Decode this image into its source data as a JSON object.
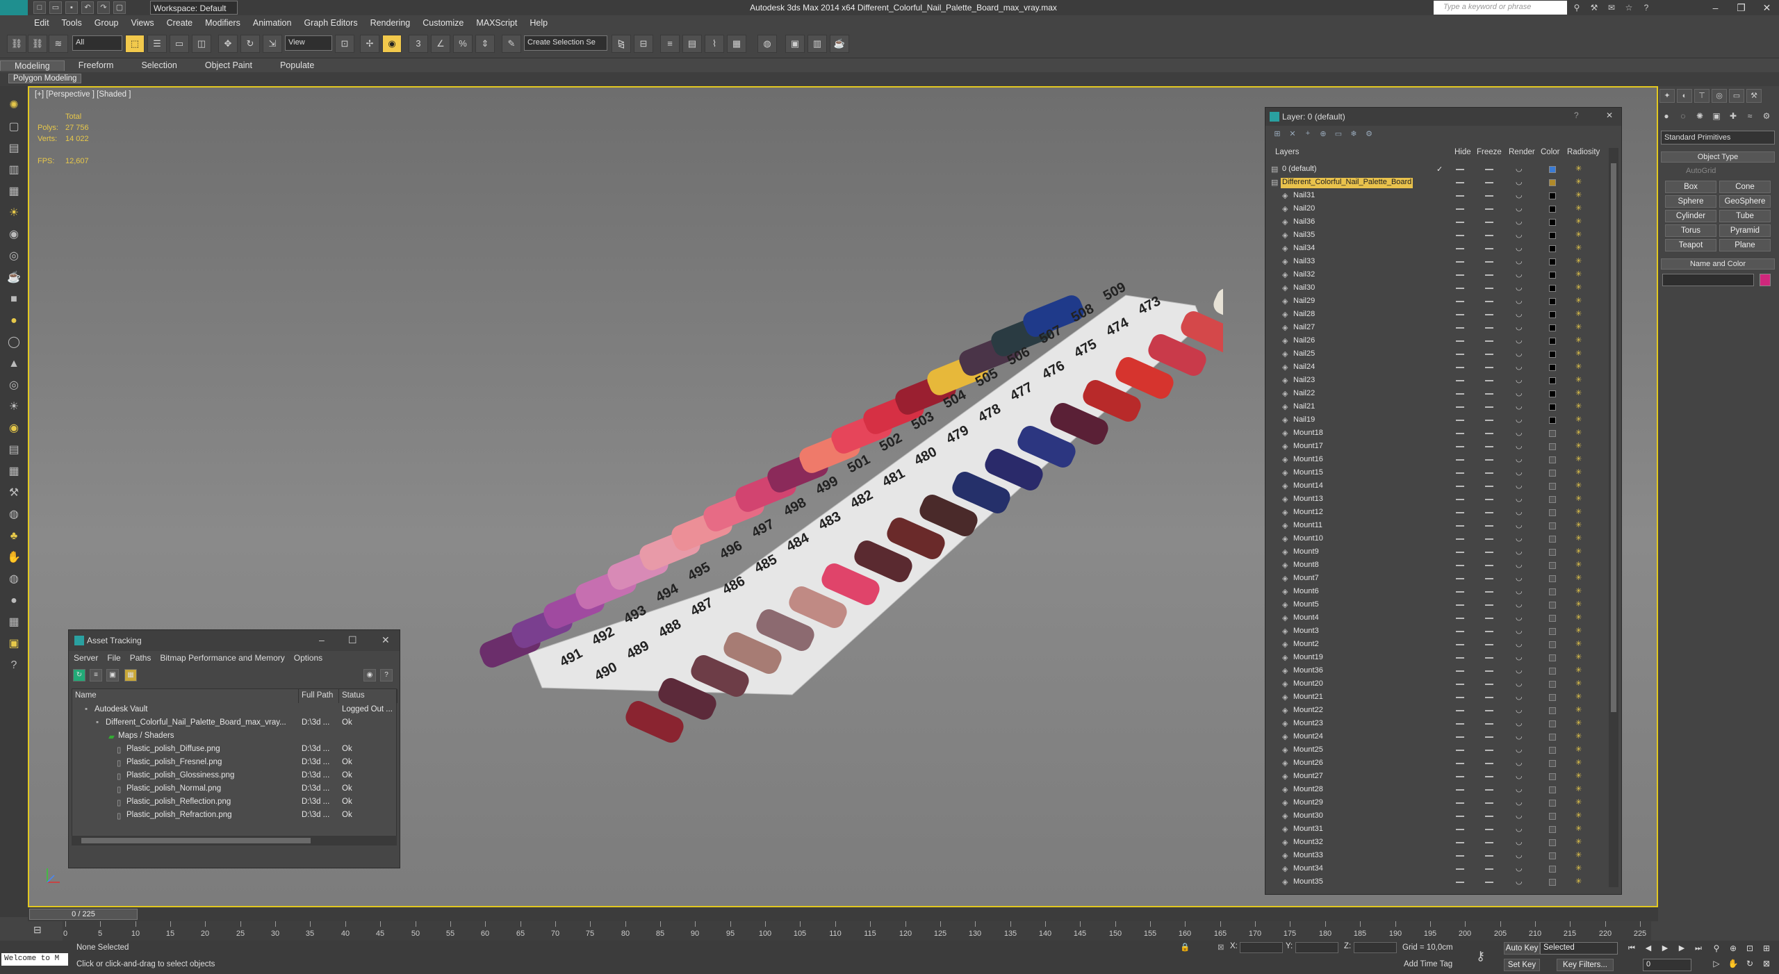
{
  "app": {
    "title": "Autodesk 3ds Max  2014 x64    Different_Colorful_Nail_Palette_Board_max_vray.max",
    "workspace": "Workspace: Default",
    "search_placeholder": "Type a keyword or phrase"
  },
  "menu": [
    "Edit",
    "Tools",
    "Group",
    "Views",
    "Create",
    "Modifiers",
    "Animation",
    "Graph Editors",
    "Rendering",
    "Customize",
    "MAXScript",
    "Help"
  ],
  "toolbar": {
    "filter": "All",
    "view": "View",
    "selection_set": "Create Selection Se"
  },
  "ribbon": {
    "tabs": [
      "Modeling",
      "Freeform",
      "Selection",
      "Object Paint",
      "Populate"
    ],
    "active": "Modeling",
    "sub": "Polygon Modeling"
  },
  "viewport": {
    "label": "[+] [Perspective ] [Shaded ]",
    "stats": {
      "total_label": "Total",
      "polys_label": "Polys:",
      "polys": "27 756",
      "verts_label": "Verts:",
      "verts": "14 022",
      "fps_label": "FPS:",
      "fps": "12,607"
    }
  },
  "board": {
    "numbers_top": [
      "491",
      "492",
      "493",
      "494",
      "495",
      "496",
      "497",
      "498",
      "499",
      "501",
      "502",
      "503",
      "504",
      "505",
      "506",
      "507",
      "508",
      "509"
    ],
    "numbers_bottom": [
      "490",
      "489",
      "488",
      "487",
      "486",
      "485",
      "484",
      "483",
      "482",
      "481",
      "480",
      "479",
      "478",
      "477",
      "476",
      "475",
      "474",
      "473"
    ]
  },
  "asset_tracking": {
    "title": "Asset Tracking",
    "menu": [
      "Server",
      "File",
      "Paths",
      "Bitmap Performance and Memory",
      "Options"
    ],
    "columns": [
      "Name",
      "Full Path",
      "Status"
    ],
    "rows": [
      {
        "name": "Autodesk Vault",
        "path": "",
        "status": "Logged Out ..."
      },
      {
        "name": "Different_Colorful_Nail_Palette_Board_max_vray...",
        "path": "D:\\3d ...",
        "status": "Ok"
      },
      {
        "name": "Maps / Shaders",
        "path": "",
        "status": ""
      },
      {
        "name": "Plastic_polish_Diffuse.png",
        "path": "D:\\3d ...",
        "status": "Ok"
      },
      {
        "name": "Plastic_polish_Fresnel.png",
        "path": "D:\\3d ...",
        "status": "Ok"
      },
      {
        "name": "Plastic_polish_Glossiness.png",
        "path": "D:\\3d ...",
        "status": "Ok"
      },
      {
        "name": "Plastic_polish_Normal.png",
        "path": "D:\\3d ...",
        "status": "Ok"
      },
      {
        "name": "Plastic_polish_Reflection.png",
        "path": "D:\\3d ...",
        "status": "Ok"
      },
      {
        "name": "Plastic_polish_Refraction.png",
        "path": "D:\\3d ...",
        "status": "Ok"
      }
    ]
  },
  "layer_panel": {
    "title": "Layer: 0 (default)",
    "columns": [
      "Layers",
      "Hide",
      "Freeze",
      "Render",
      "Color",
      "Radiosity"
    ],
    "layers": [
      {
        "name": "0 (default)",
        "color": "#3a7bd5",
        "check": "✓"
      },
      {
        "name": "Different_Colorful_Nail_Palette_Board",
        "color": "#b08a2a",
        "check": ""
      },
      {
        "name": "Nail31",
        "color": "#000000"
      },
      {
        "name": "Nail20",
        "color": "#000000"
      },
      {
        "name": "Nail36",
        "color": "#000000"
      },
      {
        "name": "Nail35",
        "color": "#000000"
      },
      {
        "name": "Nail34",
        "color": "#000000"
      },
      {
        "name": "Nail33",
        "color": "#000000"
      },
      {
        "name": "Nail32",
        "color": "#000000"
      },
      {
        "name": "Nail30",
        "color": "#000000"
      },
      {
        "name": "Nail29",
        "color": "#000000"
      },
      {
        "name": "Nail28",
        "color": "#000000"
      },
      {
        "name": "Nail27",
        "color": "#000000"
      },
      {
        "name": "Nail26",
        "color": "#000000"
      },
      {
        "name": "Nail25",
        "color": "#000000"
      },
      {
        "name": "Nail24",
        "color": "#000000"
      },
      {
        "name": "Nail23",
        "color": "#000000"
      },
      {
        "name": "Nail22",
        "color": "#000000"
      },
      {
        "name": "Nail21",
        "color": "#000000"
      },
      {
        "name": "Nail19",
        "color": "#000000"
      },
      {
        "name": "Mount18",
        "color": "#555555"
      },
      {
        "name": "Mount17",
        "color": "#555555"
      },
      {
        "name": "Mount16",
        "color": "#555555"
      },
      {
        "name": "Mount15",
        "color": "#555555"
      },
      {
        "name": "Mount14",
        "color": "#555555"
      },
      {
        "name": "Mount13",
        "color": "#555555"
      },
      {
        "name": "Mount12",
        "color": "#555555"
      },
      {
        "name": "Mount11",
        "color": "#555555"
      },
      {
        "name": "Mount10",
        "color": "#555555"
      },
      {
        "name": "Mount9",
        "color": "#555555"
      },
      {
        "name": "Mount8",
        "color": "#555555"
      },
      {
        "name": "Mount7",
        "color": "#555555"
      },
      {
        "name": "Mount6",
        "color": "#555555"
      },
      {
        "name": "Mount5",
        "color": "#555555"
      },
      {
        "name": "Mount4",
        "color": "#555555"
      },
      {
        "name": "Mount3",
        "color": "#555555"
      },
      {
        "name": "Mount2",
        "color": "#555555"
      },
      {
        "name": "Mount19",
        "color": "#555555"
      },
      {
        "name": "Mount36",
        "color": "#555555"
      },
      {
        "name": "Mount20",
        "color": "#555555"
      },
      {
        "name": "Mount21",
        "color": "#555555"
      },
      {
        "name": "Mount22",
        "color": "#555555"
      },
      {
        "name": "Mount23",
        "color": "#555555"
      },
      {
        "name": "Mount24",
        "color": "#555555"
      },
      {
        "name": "Mount25",
        "color": "#555555"
      },
      {
        "name": "Mount26",
        "color": "#555555"
      },
      {
        "name": "Mount27",
        "color": "#555555"
      },
      {
        "name": "Mount28",
        "color": "#555555"
      },
      {
        "name": "Mount29",
        "color": "#555555"
      },
      {
        "name": "Mount30",
        "color": "#555555"
      },
      {
        "name": "Mount31",
        "color": "#555555"
      },
      {
        "name": "Mount32",
        "color": "#555555"
      },
      {
        "name": "Mount33",
        "color": "#555555"
      },
      {
        "name": "Mount34",
        "color": "#555555"
      },
      {
        "name": "Mount35",
        "color": "#555555"
      }
    ]
  },
  "command_panel": {
    "dropdown": "Standard Primitives",
    "object_type": "Object Type",
    "autogrid": "AutoGrid",
    "buttons": [
      "Box",
      "Cone",
      "Sphere",
      "GeoSphere",
      "Cylinder",
      "Tube",
      "Torus",
      "Pyramid",
      "Teapot",
      "Plane"
    ],
    "name_and_color": "Name and Color",
    "swatch": "#d0277c"
  },
  "timeline": {
    "slider": "0 / 225",
    "ticks": [
      "0",
      "5",
      "10",
      "15",
      "20",
      "25",
      "30",
      "35",
      "40",
      "45",
      "50",
      "55",
      "60",
      "65",
      "70",
      "75",
      "80",
      "85",
      "90",
      "95",
      "100",
      "105",
      "110",
      "115",
      "120",
      "125",
      "130",
      "135",
      "140",
      "145",
      "150",
      "155",
      "160",
      "165",
      "170",
      "175",
      "180",
      "185",
      "190",
      "195",
      "200",
      "205",
      "210",
      "215",
      "220",
      "225"
    ]
  },
  "status": {
    "welcome": "Welcome to M",
    "selection": "None Selected",
    "prompt": "Click or click-and-drag to select objects",
    "x": "X:",
    "y": "Y:",
    "z": "Z:",
    "grid": "Grid = 10,0cm",
    "add_time_tag": "Add Time Tag",
    "auto_key": "Auto Key",
    "set_key": "Set Key",
    "selected": "Selected",
    "key_filters": "Key Filters...",
    "frame": "0"
  }
}
